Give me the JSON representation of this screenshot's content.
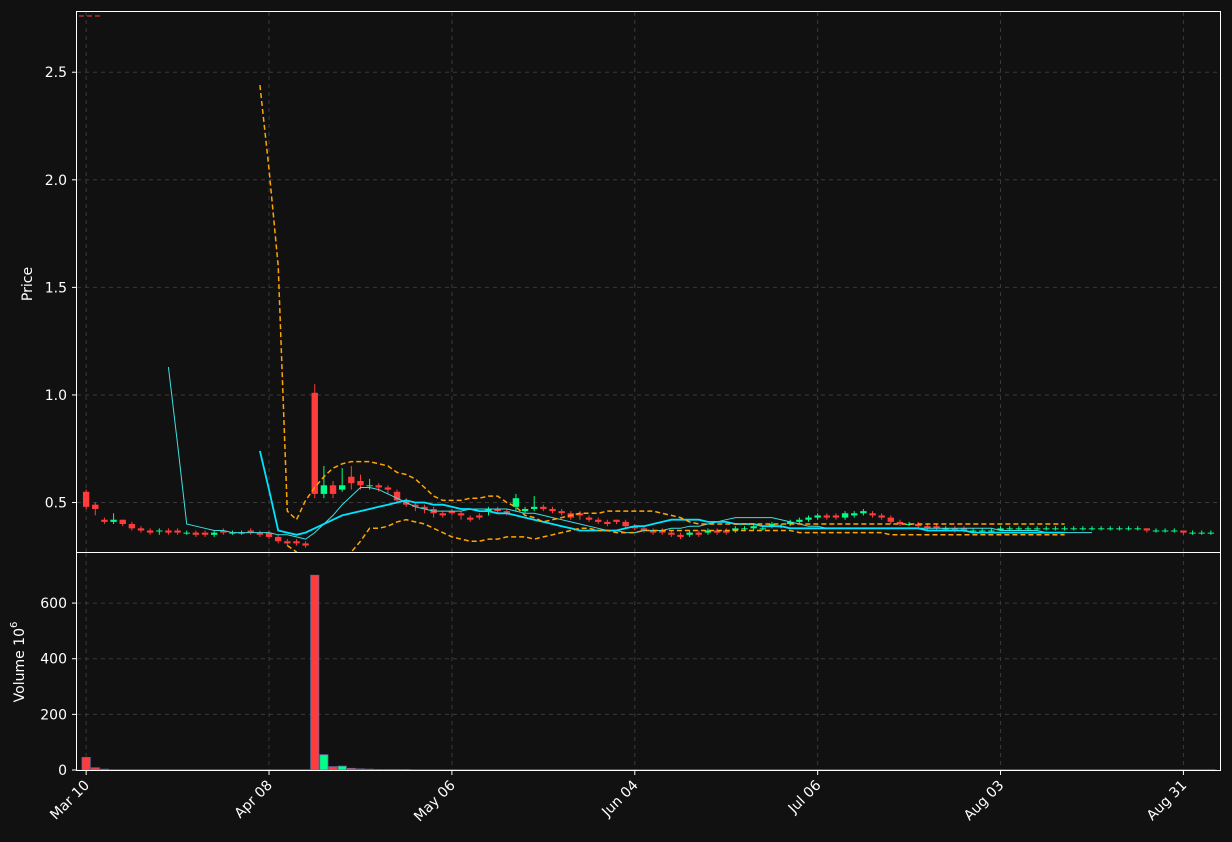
{
  "chart_data": [
    {
      "type": "candlestick",
      "ylabel": "Price",
      "ylim": [
        0.27,
        2.78
      ],
      "y_ticks": [
        "0.5",
        "1.0",
        "1.5",
        "2.0",
        "2.5"
      ],
      "y_tick_values": [
        0.5,
        1.0,
        1.5,
        2.0,
        2.5
      ],
      "x_tick_labels": [
        "Mar 10",
        "Apr 08",
        "May 06",
        "Jun 04",
        "Jul 06",
        "Aug 03",
        "Aug 31"
      ],
      "x_tick_index": [
        0,
        20,
        40,
        60,
        80,
        100,
        120
      ],
      "grid": true,
      "colors": {
        "up": "#00ff88",
        "down": "#ff3b3b",
        "ma_short": "#3ee0e0",
        "ma_long": "#00e5ff",
        "band": "#ffa500"
      },
      "candles_open": [
        0.55,
        0.49,
        0.42,
        0.41,
        0.42,
        0.4,
        0.38,
        0.37,
        0.37,
        0.37,
        0.37,
        0.36,
        0.36,
        0.36,
        0.35,
        0.37,
        0.36,
        0.36,
        0.37,
        0.36,
        0.36,
        0.34,
        0.32,
        0.32,
        0.31,
        1.01,
        0.54,
        0.58,
        0.56,
        0.62,
        0.6,
        0.58,
        0.58,
        0.57,
        0.55,
        0.51,
        0.49,
        0.48,
        0.47,
        0.45,
        0.46,
        0.45,
        0.43,
        0.44,
        0.46,
        0.47,
        0.46,
        0.48,
        0.46,
        0.47,
        0.48,
        0.47,
        0.46,
        0.45,
        0.45,
        0.43,
        0.42,
        0.41,
        0.42,
        0.41,
        0.39,
        0.38,
        0.37,
        0.37,
        0.36,
        0.35,
        0.35,
        0.36,
        0.36,
        0.37,
        0.37,
        0.37,
        0.38,
        0.38,
        0.38,
        0.39,
        0.39,
        0.4,
        0.41,
        0.42,
        0.43,
        0.44,
        0.44,
        0.43,
        0.44,
        0.45,
        0.45,
        0.44,
        0.43,
        0.41,
        0.4,
        0.4,
        0.39,
        0.39,
        0.38,
        0.38,
        0.38,
        0.37,
        0.37,
        0.37,
        0.37,
        0.38,
        0.38,
        0.38,
        0.38,
        0.38,
        0.38,
        0.38,
        0.38,
        0.38,
        0.38,
        0.38,
        0.38,
        0.38,
        0.38,
        0.38,
        0.38,
        0.37,
        0.37,
        0.37,
        0.37,
        0.36,
        0.36,
        0.36
      ],
      "candles_close": [
        0.48,
        0.47,
        0.41,
        0.42,
        0.4,
        0.38,
        0.37,
        0.36,
        0.37,
        0.36,
        0.36,
        0.36,
        0.35,
        0.35,
        0.36,
        0.36,
        0.36,
        0.36,
        0.36,
        0.35,
        0.34,
        0.32,
        0.31,
        0.31,
        0.3,
        0.54,
        0.58,
        0.54,
        0.58,
        0.59,
        0.58,
        0.58,
        0.57,
        0.56,
        0.51,
        0.49,
        0.48,
        0.47,
        0.45,
        0.44,
        0.45,
        0.44,
        0.42,
        0.43,
        0.47,
        0.46,
        0.45,
        0.52,
        0.47,
        0.48,
        0.47,
        0.46,
        0.45,
        0.43,
        0.44,
        0.42,
        0.41,
        0.4,
        0.41,
        0.39,
        0.38,
        0.37,
        0.36,
        0.36,
        0.35,
        0.34,
        0.36,
        0.35,
        0.37,
        0.36,
        0.36,
        0.38,
        0.38,
        0.39,
        0.38,
        0.4,
        0.39,
        0.41,
        0.42,
        0.43,
        0.44,
        0.43,
        0.43,
        0.45,
        0.45,
        0.46,
        0.44,
        0.43,
        0.41,
        0.4,
        0.4,
        0.39,
        0.38,
        0.38,
        0.38,
        0.37,
        0.37,
        0.37,
        0.37,
        0.37,
        0.38,
        0.38,
        0.38,
        0.38,
        0.38,
        0.38,
        0.38,
        0.38,
        0.38,
        0.38,
        0.38,
        0.38,
        0.38,
        0.38,
        0.38,
        0.38,
        0.37,
        0.37,
        0.37,
        0.37,
        0.36,
        0.36,
        0.36,
        0.36
      ],
      "candles_high": [
        0.56,
        0.5,
        0.43,
        0.45,
        0.42,
        0.41,
        0.39,
        0.38,
        0.38,
        0.38,
        0.38,
        0.37,
        0.37,
        0.37,
        0.37,
        0.38,
        0.37,
        0.37,
        0.38,
        0.37,
        0.37,
        0.35,
        0.33,
        0.33,
        0.32,
        1.05,
        0.67,
        0.6,
        0.66,
        0.67,
        0.63,
        0.61,
        0.59,
        0.58,
        0.56,
        0.52,
        0.5,
        0.49,
        0.48,
        0.46,
        0.47,
        0.46,
        0.44,
        0.45,
        0.48,
        0.48,
        0.47,
        0.54,
        0.48,
        0.53,
        0.49,
        0.48,
        0.47,
        0.46,
        0.46,
        0.44,
        0.43,
        0.42,
        0.42,
        0.42,
        0.4,
        0.39,
        0.38,
        0.38,
        0.37,
        0.36,
        0.37,
        0.37,
        0.38,
        0.38,
        0.38,
        0.39,
        0.39,
        0.4,
        0.39,
        0.41,
        0.4,
        0.42,
        0.43,
        0.44,
        0.45,
        0.45,
        0.45,
        0.46,
        0.46,
        0.47,
        0.46,
        0.45,
        0.44,
        0.42,
        0.41,
        0.41,
        0.4,
        0.4,
        0.39,
        0.39,
        0.39,
        0.38,
        0.38,
        0.38,
        0.39,
        0.39,
        0.39,
        0.39,
        0.39,
        0.39,
        0.39,
        0.39,
        0.39,
        0.39,
        0.39,
        0.39,
        0.39,
        0.39,
        0.39,
        0.39,
        0.38,
        0.38,
        0.38,
        0.38,
        0.37,
        0.37,
        0.37,
        0.37
      ],
      "candles_low": [
        0.47,
        0.44,
        0.4,
        0.4,
        0.39,
        0.37,
        0.36,
        0.35,
        0.35,
        0.35,
        0.35,
        0.35,
        0.34,
        0.34,
        0.34,
        0.35,
        0.35,
        0.35,
        0.35,
        0.34,
        0.33,
        0.31,
        0.3,
        0.3,
        0.29,
        0.52,
        0.52,
        0.52,
        0.55,
        0.56,
        0.56,
        0.56,
        0.55,
        0.54,
        0.5,
        0.48,
        0.46,
        0.45,
        0.43,
        0.43,
        0.44,
        0.42,
        0.41,
        0.42,
        0.44,
        0.45,
        0.44,
        0.46,
        0.45,
        0.46,
        0.46,
        0.45,
        0.44,
        0.42,
        0.42,
        0.41,
        0.4,
        0.39,
        0.4,
        0.38,
        0.37,
        0.36,
        0.35,
        0.35,
        0.34,
        0.33,
        0.34,
        0.34,
        0.35,
        0.35,
        0.35,
        0.36,
        0.37,
        0.37,
        0.37,
        0.38,
        0.38,
        0.39,
        0.4,
        0.41,
        0.42,
        0.42,
        0.42,
        0.42,
        0.43,
        0.44,
        0.43,
        0.42,
        0.4,
        0.39,
        0.39,
        0.38,
        0.37,
        0.37,
        0.37,
        0.36,
        0.36,
        0.36,
        0.36,
        0.36,
        0.37,
        0.37,
        0.37,
        0.37,
        0.37,
        0.37,
        0.37,
        0.37,
        0.37,
        0.37,
        0.37,
        0.37,
        0.37,
        0.37,
        0.37,
        0.37,
        0.36,
        0.36,
        0.36,
        0.36,
        0.35,
        0.35,
        0.35,
        0.35
      ],
      "ma_short": {
        "start": 9,
        "values": [
          1.13,
          0.77,
          0.4,
          0.39,
          0.38,
          0.37,
          0.37,
          0.36,
          0.36,
          0.36,
          0.36,
          0.36,
          0.35,
          0.35,
          0.34,
          0.33,
          0.36,
          0.4,
          0.44,
          0.49,
          0.53,
          0.57,
          0.57,
          0.56,
          0.54,
          0.52,
          0.5,
          0.48,
          0.47,
          0.46,
          0.46,
          0.46,
          0.46,
          0.47,
          0.47,
          0.47,
          0.47,
          0.47,
          0.46,
          0.45,
          0.45,
          0.44,
          0.43,
          0.42,
          0.41,
          0.4,
          0.39,
          0.38,
          0.37,
          0.37,
          0.36,
          0.36,
          0.37,
          0.37,
          0.37,
          0.38,
          0.38,
          0.39,
          0.39,
          0.4,
          0.41,
          0.42,
          0.43,
          0.43,
          0.43,
          0.43,
          0.43,
          0.42,
          0.41,
          0.4,
          0.39,
          0.39,
          0.38,
          0.38,
          0.38,
          0.38,
          0.38,
          0.38,
          0.38,
          0.38,
          0.38,
          0.38,
          0.38,
          0.38,
          0.38,
          0.38,
          0.38,
          0.38,
          0.38,
          0.38,
          0.38,
          0.37,
          0.37,
          0.37,
          0.37,
          0.37,
          0.36,
          0.36,
          0.36,
          0.36,
          0.36,
          0.36
        ]
      },
      "ma_long": {
        "start": 19,
        "values": [
          0.74,
          0.56,
          0.37,
          0.36,
          0.35,
          0.36,
          0.38,
          0.4,
          0.42,
          0.44,
          0.45,
          0.46,
          0.47,
          0.48,
          0.49,
          0.5,
          0.51,
          0.5,
          0.5,
          0.49,
          0.49,
          0.48,
          0.47,
          0.47,
          0.46,
          0.46,
          0.45,
          0.45,
          0.44,
          0.43,
          0.42,
          0.41,
          0.4,
          0.39,
          0.38,
          0.37,
          0.37,
          0.37,
          0.37,
          0.37,
          0.38,
          0.39,
          0.39,
          0.4,
          0.41,
          0.42,
          0.42,
          0.42,
          0.42,
          0.41,
          0.41,
          0.41,
          0.4,
          0.4,
          0.4,
          0.39,
          0.39,
          0.39,
          0.38,
          0.38,
          0.38,
          0.38,
          0.38,
          0.38,
          0.38,
          0.38,
          0.38,
          0.38,
          0.38,
          0.38,
          0.38,
          0.38,
          0.38,
          0.37,
          0.37,
          0.37,
          0.37,
          0.37,
          0.36,
          0.36,
          0.36,
          0.36,
          0.36,
          0.36,
          0.36,
          0.36,
          0.36,
          0.36,
          0.36
        ]
      },
      "band_upper": {
        "start": 19,
        "values": [
          2.44,
          2.05,
          1.6,
          0.46,
          0.42,
          0.51,
          0.57,
          0.62,
          0.66,
          0.68,
          0.69,
          0.69,
          0.69,
          0.68,
          0.67,
          0.64,
          0.63,
          0.61,
          0.57,
          0.53,
          0.51,
          0.51,
          0.51,
          0.52,
          0.52,
          0.53,
          0.53,
          0.5,
          0.48,
          0.44,
          0.43,
          0.41,
          0.42,
          0.43,
          0.44,
          0.45,
          0.45,
          0.45,
          0.46,
          0.46,
          0.46,
          0.46,
          0.46,
          0.46,
          0.45,
          0.44,
          0.43,
          0.41,
          0.4,
          0.4,
          0.4,
          0.4,
          0.4,
          0.4,
          0.4,
          0.4,
          0.4,
          0.4,
          0.4,
          0.4,
          0.4,
          0.4,
          0.4,
          0.4,
          0.4,
          0.4,
          0.4,
          0.4,
          0.4,
          0.4,
          0.4,
          0.4,
          0.4,
          0.4,
          0.4,
          0.4,
          0.4,
          0.4,
          0.4,
          0.4,
          0.4,
          0.4,
          0.4,
          0.4,
          0.4,
          0.4,
          0.4,
          0.4,
          0.4
        ]
      },
      "band_lower": {
        "start": 22,
        "values": [
          0.3,
          0.27,
          0.2,
          0.12,
          0.08,
          0.12,
          0.2,
          0.27,
          0.32,
          0.38,
          0.38,
          0.39,
          0.41,
          0.42,
          0.41,
          0.4,
          0.38,
          0.36,
          0.34,
          0.33,
          0.32,
          0.32,
          0.33,
          0.33,
          0.34,
          0.34,
          0.34,
          0.33,
          0.34,
          0.35,
          0.36,
          0.37,
          0.38,
          0.38,
          0.37,
          0.37,
          0.36,
          0.36,
          0.36,
          0.37,
          0.37,
          0.37,
          0.37,
          0.37,
          0.37,
          0.37,
          0.37,
          0.37,
          0.37,
          0.37,
          0.37,
          0.37,
          0.37,
          0.37,
          0.37,
          0.37,
          0.36,
          0.36,
          0.36,
          0.36,
          0.36,
          0.36,
          0.36,
          0.36,
          0.36,
          0.36,
          0.35,
          0.35,
          0.35,
          0.35,
          0.35,
          0.35,
          0.35,
          0.35,
          0.35,
          0.35,
          0.35,
          0.35,
          0.35,
          0.35,
          0.35,
          0.35,
          0.35,
          0.35,
          0.35,
          0.35
        ]
      }
    },
    {
      "type": "bar",
      "ylabel": "Volume  10",
      "ylabel_exponent": "6",
      "ylim": [
        0,
        780
      ],
      "y_ticks": [
        "0",
        "200",
        "400",
        "600"
      ],
      "y_tick_values": [
        0,
        200,
        400,
        600
      ],
      "grid": true,
      "values": [
        45,
        8,
        3,
        1,
        1,
        1,
        1,
        1,
        1,
        1,
        1,
        1,
        1,
        1,
        1,
        1,
        1,
        1,
        1,
        1,
        1,
        1,
        1,
        1,
        1,
        700,
        55,
        12,
        14,
        6,
        4,
        3,
        2,
        2,
        2,
        2,
        1,
        1,
        1,
        1,
        1,
        1,
        1,
        1,
        1,
        1,
        1,
        1,
        1,
        1,
        1,
        1,
        1,
        1,
        1,
        1,
        1,
        1,
        1,
        1,
        1,
        1,
        1,
        1,
        1,
        1,
        1,
        1,
        1,
        1,
        1,
        1,
        1,
        1,
        1,
        1,
        1,
        1,
        1,
        1,
        1,
        1,
        1,
        1,
        1,
        1,
        1,
        1,
        1,
        1,
        1,
        1,
        1,
        1,
        1,
        1,
        1,
        1,
        1,
        1,
        1,
        1,
        1,
        1,
        1,
        1,
        1,
        1,
        1,
        1,
        1,
        1,
        1,
        1,
        1,
        1,
        1,
        1,
        1,
        1,
        1,
        1,
        1,
        1
      ]
    }
  ]
}
